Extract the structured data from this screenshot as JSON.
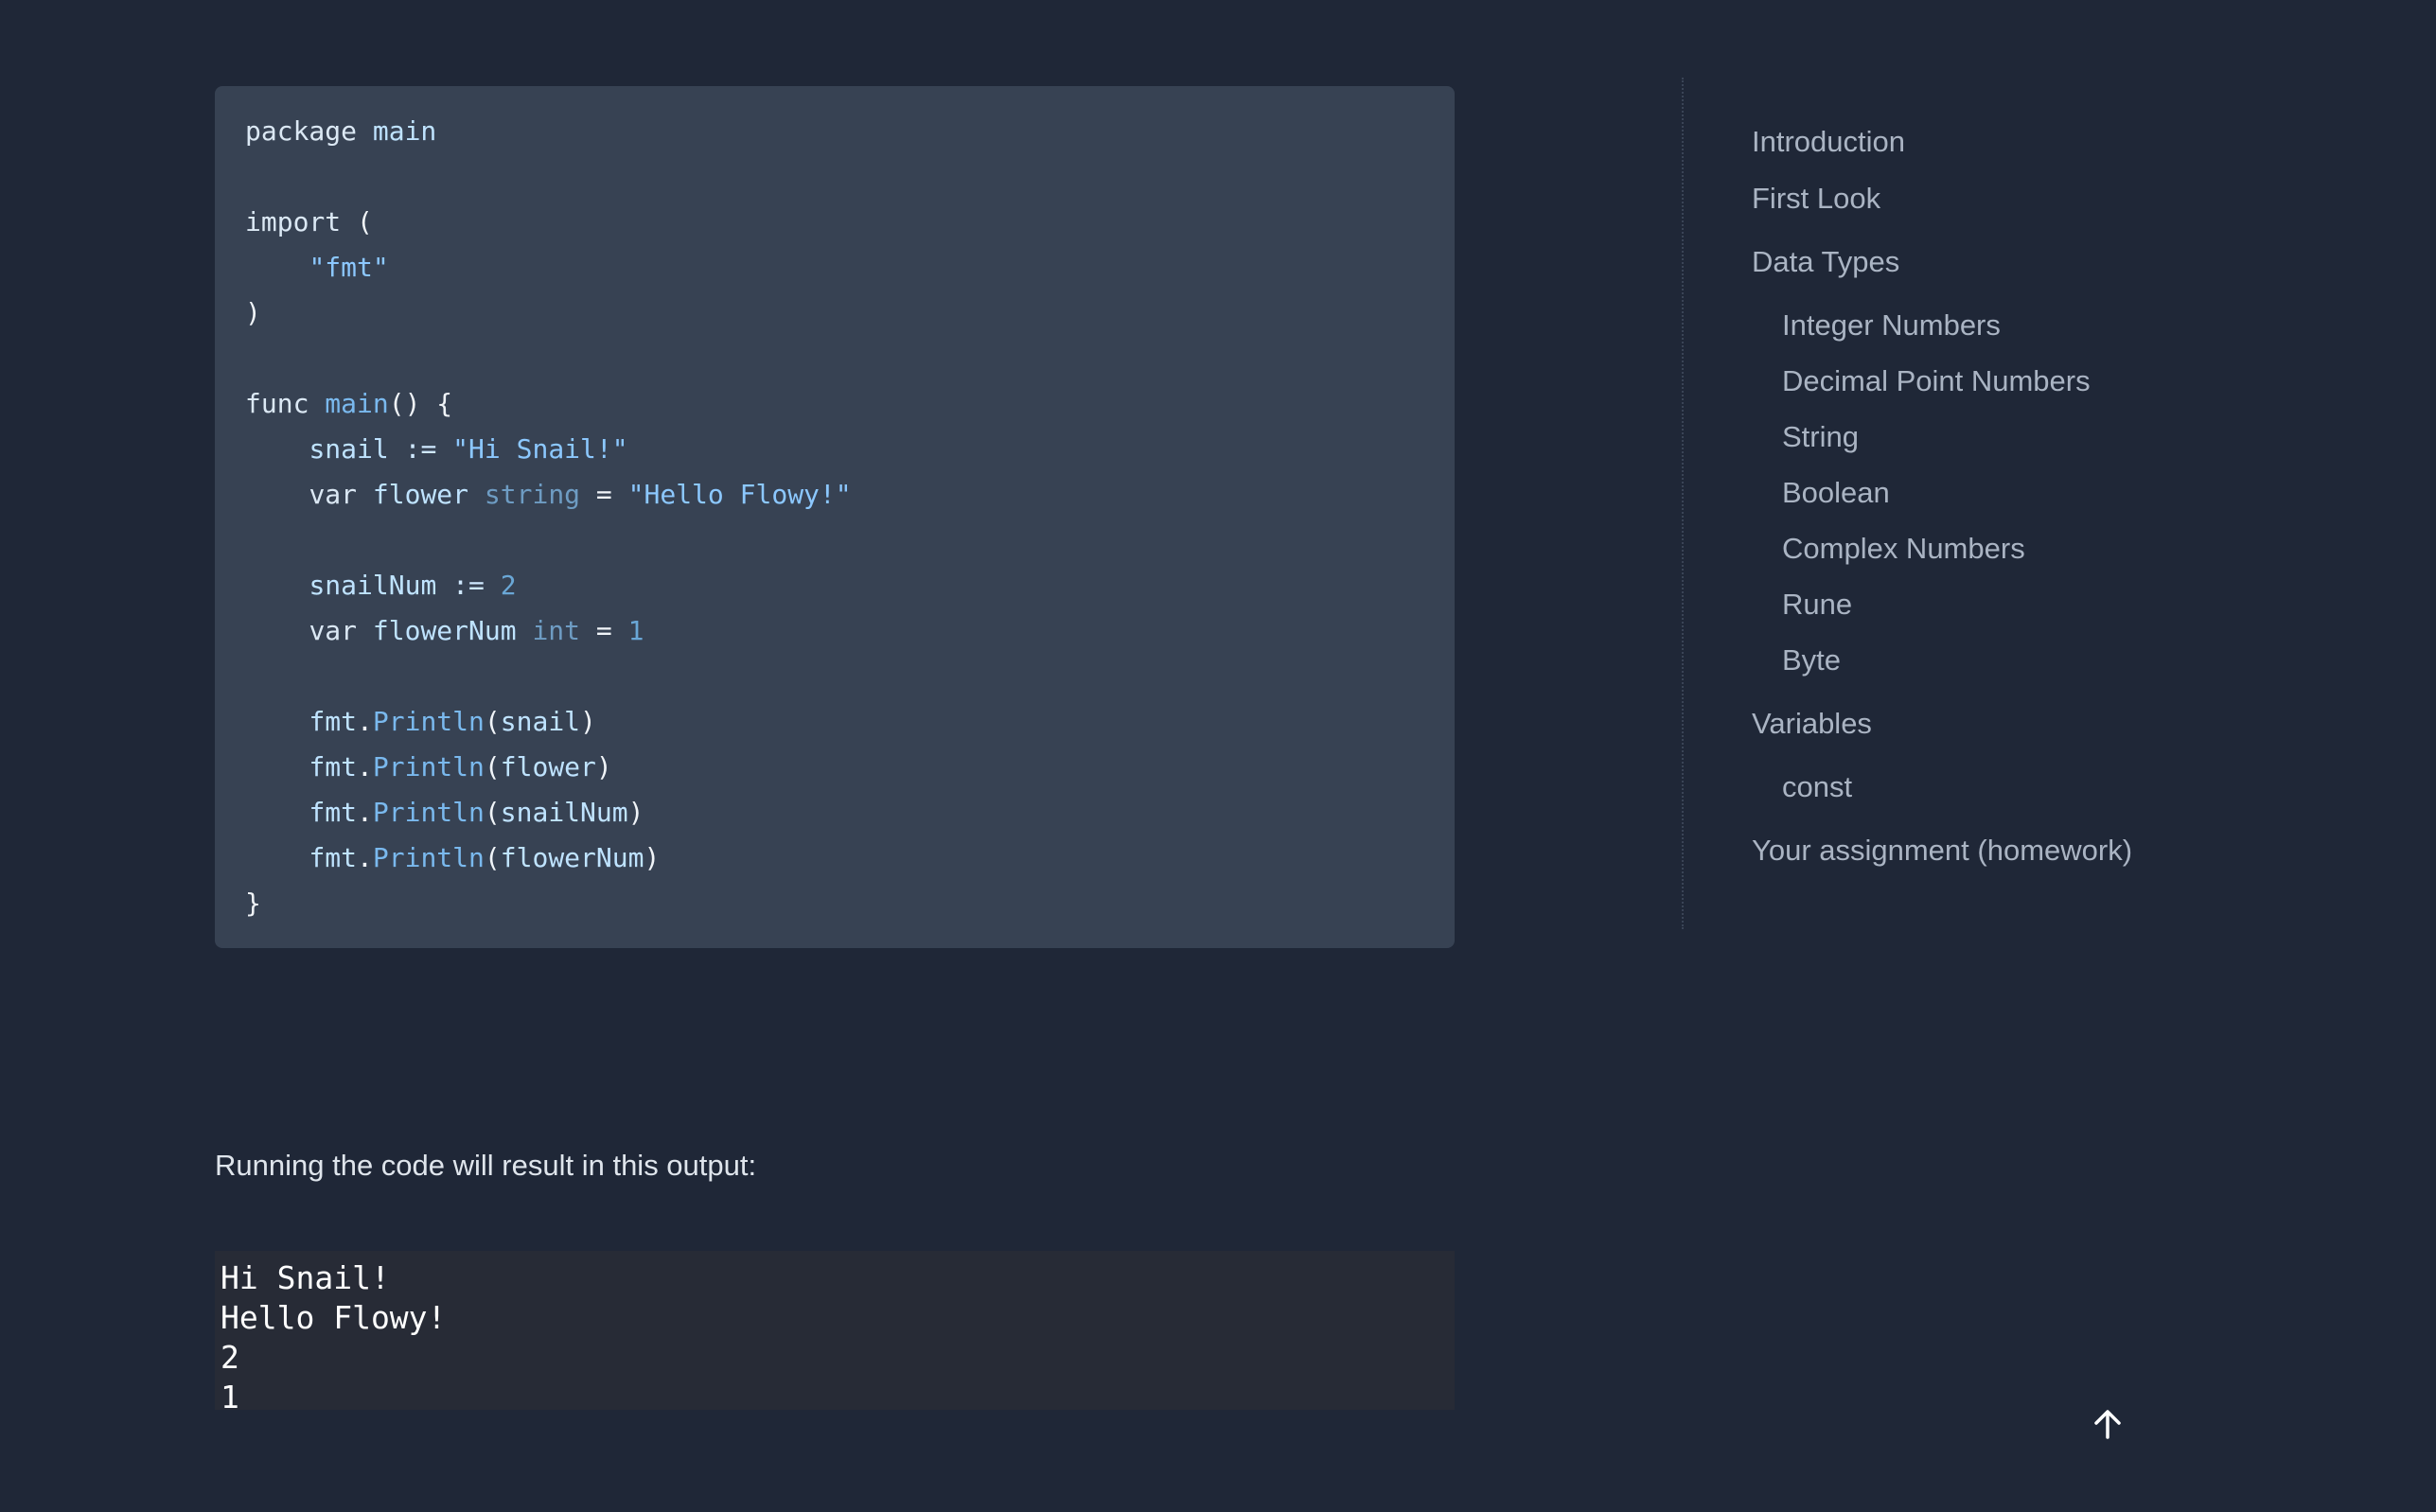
{
  "code": {
    "lines": [
      [
        {
          "t": "package ",
          "c": "kw"
        },
        {
          "t": "main",
          "c": "id"
        }
      ],
      [],
      [
        {
          "t": "import ",
          "c": "kw"
        },
        {
          "t": "(",
          "c": "punc"
        }
      ],
      [
        {
          "t": "    ",
          "c": "punc"
        },
        {
          "t": "\"fmt\"",
          "c": "str"
        }
      ],
      [
        {
          "t": ")",
          "c": "punc"
        }
      ],
      [],
      [
        {
          "t": "func ",
          "c": "kw"
        },
        {
          "t": "main",
          "c": "fn"
        },
        {
          "t": "() {",
          "c": "punc"
        }
      ],
      [
        {
          "t": "    ",
          "c": "punc"
        },
        {
          "t": "snail ",
          "c": "id"
        },
        {
          "t": ":= ",
          "c": "op"
        },
        {
          "t": "\"Hi Snail!\"",
          "c": "str"
        }
      ],
      [
        {
          "t": "    ",
          "c": "punc"
        },
        {
          "t": "var ",
          "c": "kw"
        },
        {
          "t": "flower ",
          "c": "id"
        },
        {
          "t": "string ",
          "c": "type"
        },
        {
          "t": "= ",
          "c": "punc"
        },
        {
          "t": "\"Hello Flowy!\"",
          "c": "str"
        }
      ],
      [],
      [
        {
          "t": "    ",
          "c": "punc"
        },
        {
          "t": "snailNum ",
          "c": "id"
        },
        {
          "t": ":= ",
          "c": "op"
        },
        {
          "t": "2",
          "c": "num"
        }
      ],
      [
        {
          "t": "    ",
          "c": "punc"
        },
        {
          "t": "var ",
          "c": "kw"
        },
        {
          "t": "flowerNum ",
          "c": "id"
        },
        {
          "t": "int ",
          "c": "type"
        },
        {
          "t": "= ",
          "c": "punc"
        },
        {
          "t": "1",
          "c": "num"
        }
      ],
      [],
      [
        {
          "t": "    ",
          "c": "punc"
        },
        {
          "t": "fmt",
          "c": "id"
        },
        {
          "t": ".",
          "c": "punc"
        },
        {
          "t": "Println",
          "c": "fn"
        },
        {
          "t": "(",
          "c": "punc"
        },
        {
          "t": "snail",
          "c": "id"
        },
        {
          "t": ")",
          "c": "punc"
        }
      ],
      [
        {
          "t": "    ",
          "c": "punc"
        },
        {
          "t": "fmt",
          "c": "id"
        },
        {
          "t": ".",
          "c": "punc"
        },
        {
          "t": "Println",
          "c": "fn"
        },
        {
          "t": "(",
          "c": "punc"
        },
        {
          "t": "flower",
          "c": "id"
        },
        {
          "t": ")",
          "c": "punc"
        }
      ],
      [
        {
          "t": "    ",
          "c": "punc"
        },
        {
          "t": "fmt",
          "c": "id"
        },
        {
          "t": ".",
          "c": "punc"
        },
        {
          "t": "Println",
          "c": "fn"
        },
        {
          "t": "(",
          "c": "punc"
        },
        {
          "t": "snailNum",
          "c": "id"
        },
        {
          "t": ")",
          "c": "punc"
        }
      ],
      [
        {
          "t": "    ",
          "c": "punc"
        },
        {
          "t": "fmt",
          "c": "id"
        },
        {
          "t": ".",
          "c": "punc"
        },
        {
          "t": "Println",
          "c": "fn"
        },
        {
          "t": "(",
          "c": "punc"
        },
        {
          "t": "flowerNum",
          "c": "id"
        },
        {
          "t": ")",
          "c": "punc"
        }
      ],
      [
        {
          "t": "}",
          "c": "punc"
        }
      ]
    ]
  },
  "output": {
    "caption": "Running the code will result in this output:",
    "lines": [
      "Hi Snail!",
      "Hello Flowy!",
      "2",
      "1"
    ]
  },
  "toc": {
    "items": [
      {
        "label": "Introduction",
        "level": 0
      },
      {
        "label": "First Look",
        "level": 0
      },
      {
        "label": "Data Types",
        "level": 0
      },
      {
        "label": "Integer Numbers",
        "level": 1
      },
      {
        "label": "Decimal Point Numbers",
        "level": 1
      },
      {
        "label": "String",
        "level": 1
      },
      {
        "label": "Boolean",
        "level": 1
      },
      {
        "label": "Complex Numbers",
        "level": 1
      },
      {
        "label": "Rune",
        "level": 1
      },
      {
        "label": "Byte",
        "level": 1
      },
      {
        "label": "Variables",
        "level": 0
      },
      {
        "label": "const",
        "level": 1
      },
      {
        "label": "Your assignment (homework)",
        "level": 0
      }
    ]
  },
  "scroll_top": {
    "icon": "arrow-up-icon"
  }
}
